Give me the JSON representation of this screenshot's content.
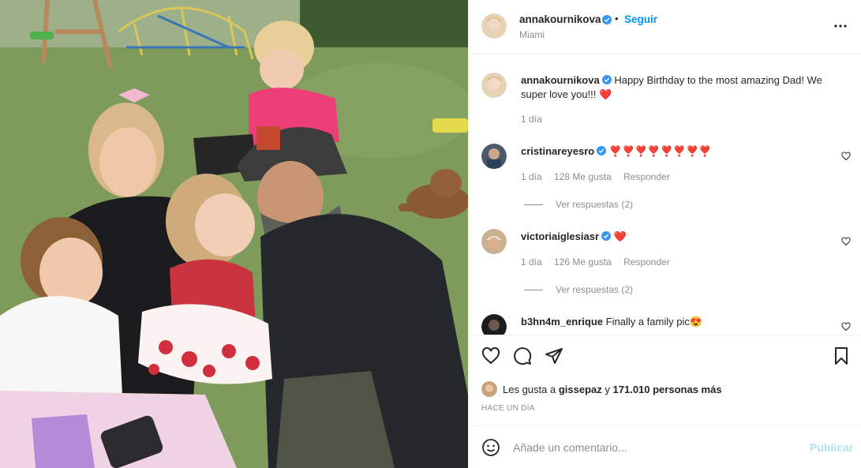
{
  "photo": {
    "alt_kind": "family-photo"
  },
  "header": {
    "username": "annakournikova",
    "separator": "•",
    "follow_label": "Seguir",
    "location": "Miami"
  },
  "caption": {
    "username": "annakournikova",
    "text": "Happy Birthday to the most amazing Dad! We super love you!!! ",
    "emoji": "❤️",
    "time": "1 día"
  },
  "comments": [
    {
      "username": "cristinareyesro",
      "verified": true,
      "text": "❣️❣️❣️❣️❣️❣️❣️❣️",
      "time": "1 día",
      "likes": "128 Me gusta",
      "reply_label": "Responder",
      "view_replies": "Ver respuestas (2)"
    },
    {
      "username": "victoriaiglesiasr",
      "verified": true,
      "text": "❤️",
      "time": "1 día",
      "likes": "126 Me gusta",
      "reply_label": "Responder",
      "view_replies": "Ver respuestas (2)"
    },
    {
      "username": "b3hn4m_enrique",
      "verified": false,
      "text": "Finally a family pic😍"
    }
  ],
  "likes": {
    "prefix": "Les gusta a",
    "user": "gissepaz",
    "joiner": "y",
    "others": "171.010 personas más"
  },
  "time_ago": "HACE UN DÍA",
  "add_comment": {
    "placeholder": "Añade un comentario...",
    "publish_label": "Publicar"
  },
  "colors": {
    "link_blue": "#0095f6",
    "publish_disabled": "#b2dffc",
    "heart_red": "#ed4956",
    "verified_blue": "#3897f0"
  }
}
